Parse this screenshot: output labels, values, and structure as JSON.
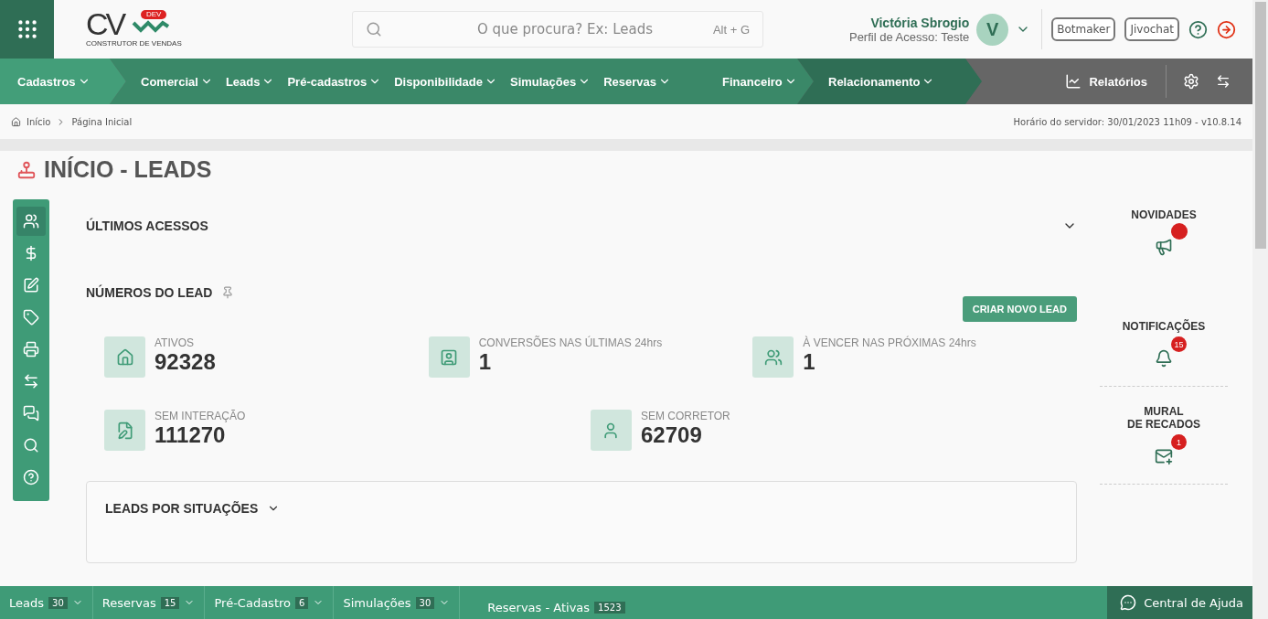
{
  "logo": {
    "letters": "CV",
    "badge": "DEV",
    "tagline": "CONSTRUTOR DE VENDAS"
  },
  "search": {
    "placeholder": "O que procura? Ex: Leads",
    "shortcut": "Alt + G"
  },
  "user": {
    "name": "Victória Sbrogio",
    "profile": "Perfil de Acesso: Teste",
    "initial": "V"
  },
  "header_buttons": [
    "Botmaker",
    "Jivochat"
  ],
  "nav_segments": [
    {
      "color": "#439e79",
      "items": [
        "Cadastros"
      ]
    },
    {
      "color": "#3a8868",
      "items": [
        "Comercial",
        "Leads",
        "Pré-cadastros",
        "Disponibilidade",
        "Simulações",
        "Reservas",
        "Financeiro"
      ]
    },
    {
      "color": "#2f6e55",
      "items": [
        "Relacionamento"
      ]
    }
  ],
  "reports": {
    "label": "Relatórios"
  },
  "breadcrumb": [
    "Início",
    "Página Inicial"
  ],
  "server_info": "Horário do servidor: 30/01/2023 11h09 - v10.8.14",
  "page_title": "INÍCIO - LEADS",
  "sidebar": [
    {
      "selected": true
    },
    {
      "selected": false
    },
    {
      "selected": false
    },
    {
      "selected": false
    },
    {
      "selected": false
    },
    {
      "selected": false
    },
    {
      "selected": false
    },
    {
      "selected": false
    },
    {
      "selected": false
    }
  ],
  "recent_access": {
    "title": "ÚLTIMOS ACESSOS",
    "expanded": false
  },
  "lead_numbers": {
    "title": "NÚMEROS DO LEAD",
    "button": "CRIAR NOVO LEAD",
    "stats": [
      {
        "label": "ATIVOS",
        "value": "92328"
      },
      {
        "label": "CONVERSÕES NAS ÚLTIMAS 24hrs",
        "value": "1"
      },
      {
        "label": "À VENCER NAS PRÓXIMAS 24hrs",
        "value": "1"
      },
      {
        "label": "SEM INTERAÇÃO",
        "value": "111270"
      },
      {
        "label": "SEM CORRETOR",
        "value": "62709"
      }
    ]
  },
  "situations": {
    "title": "LEADS POR SITUAÇÕES"
  },
  "right_panel": [
    {
      "title": "NOVIDADES",
      "dot": true
    },
    {
      "title": "NOTIFICAÇÕES",
      "badge": "15"
    },
    {
      "title": "MURAL\nDE RECADOS",
      "badge": "1"
    }
  ],
  "footer_tabs": [
    {
      "label": "Leads",
      "count": "30",
      "dropdown": true
    },
    {
      "label": "Reservas",
      "count": "15",
      "dropdown": true
    },
    {
      "label": "Pré-Cadastro",
      "count": "6",
      "dropdown": true
    },
    {
      "label": "Simulações",
      "count": "30",
      "dropdown": true
    },
    {
      "label": "Reservas - Ativas",
      "count": "1523",
      "dropdown": false
    }
  ],
  "help": {
    "label": "Central de Ajuda"
  }
}
